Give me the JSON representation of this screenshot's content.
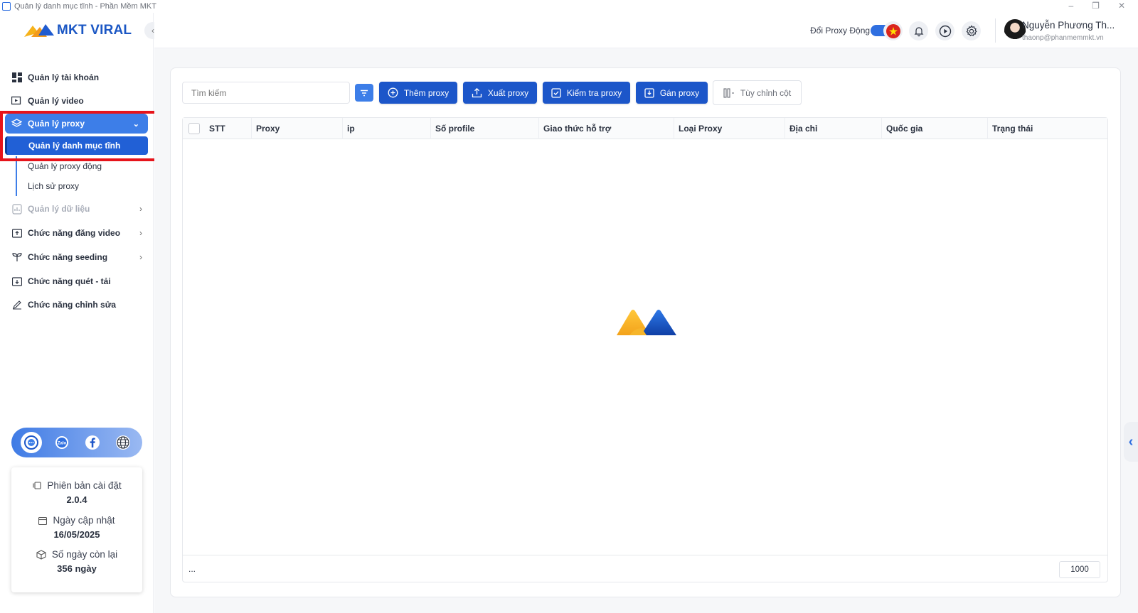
{
  "window": {
    "title": "Quản lý danh mục tĩnh - Phần Mềm MKT",
    "controls": [
      "–",
      "❐",
      "✕"
    ]
  },
  "brand": {
    "logo_text": "MKT VIRAL"
  },
  "sidebar": {
    "items": [
      {
        "label": "Quản lý tài khoản",
        "icon": "dashboard-icon"
      },
      {
        "label": "Quản lý video",
        "icon": "video-icon"
      },
      {
        "label": "Quản lý proxy",
        "icon": "layers-icon",
        "active": true
      },
      {
        "label": "Quản lý dữ liệu",
        "icon": "data-icon",
        "disabled": true
      },
      {
        "label": "Chức năng đăng video",
        "icon": "upload-icon"
      },
      {
        "label": "Chức năng seeding",
        "icon": "seeding-icon"
      },
      {
        "label": "Chức năng quét - tải",
        "icon": "download-icon"
      },
      {
        "label": "Chức năng chỉnh sửa",
        "icon": "edit-icon"
      }
    ],
    "proxy_sub": [
      {
        "label": "Quản lý danh mục tĩnh",
        "active": true
      },
      {
        "label": "Quản lý proxy động"
      },
      {
        "label": "Lịch sử proxy"
      }
    ],
    "info": {
      "version_label": "Phiên bản cài đặt",
      "version_value": "2.0.4",
      "update_label": "Ngày cập nhật",
      "update_value": "16/05/2025",
      "days_label": "Số ngày còn lại",
      "days_value": "356 ngày"
    },
    "social_icons": [
      "support-icon",
      "zalo-icon",
      "facebook-icon",
      "globe-icon"
    ]
  },
  "header": {
    "proxy_toggle_label": "Đổi Proxy Động",
    "proxy_toggle_on": true,
    "user_name": "Nguyễn Phương Th...",
    "user_email": "thaonp@phanmemmkt.vn"
  },
  "toolbar": {
    "search_placeholder": "Tìm kiếm",
    "add_proxy": "Thêm proxy",
    "export_proxy": "Xuất proxy",
    "check_proxy": "Kiểm tra proxy",
    "assign_proxy": "Gán proxy",
    "customize_columns": "Tùy chỉnh cột"
  },
  "table": {
    "columns": [
      "STT",
      "Proxy",
      "ip",
      "Số profile",
      "Giao thức hỗ trợ",
      "Loại Proxy",
      "Địa chỉ",
      "Quốc gia",
      "Trạng thái"
    ],
    "footer_text": "...",
    "page_size": "1000"
  },
  "colors": {
    "primary": "#1c56c9",
    "accent": "#3d7ee8",
    "highlight": "#e6141b"
  }
}
